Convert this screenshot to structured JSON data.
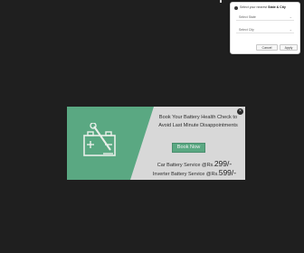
{
  "location": {
    "prompt": "Select your nearest",
    "state_city": "State & City",
    "state_placeholder": "Select State",
    "city_placeholder": "Select City",
    "cancel_label": "Cancel",
    "apply_label": "Apply"
  },
  "popup": {
    "headline": "Book Your Battery Health Check to Avoid Last Minute Disappointments",
    "cta_label": "Book Now",
    "car_prefix": "Car Battery Service @Rs.",
    "car_price": "299/-",
    "inverter_prefix": "Inverter Battery Service @Rs.",
    "inverter_price": "599/-",
    "close_label": "×"
  },
  "colors": {
    "page_bg": "#1f1f1f",
    "popup_green": "#5aa882",
    "popup_grey": "#d8d8d8"
  }
}
